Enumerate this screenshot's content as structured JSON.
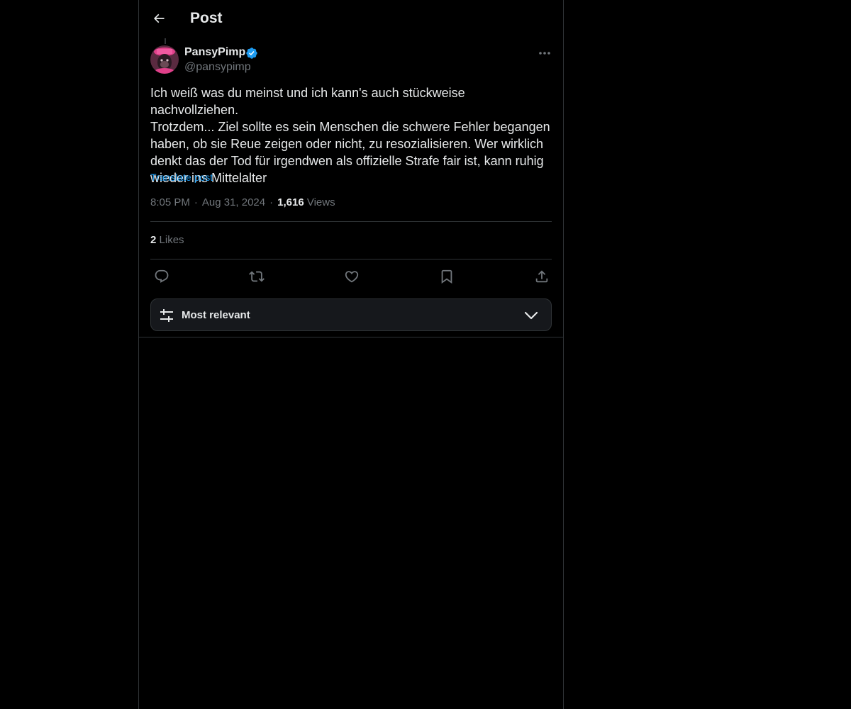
{
  "header": {
    "title": "Post"
  },
  "author": {
    "name": "PansyPimp",
    "handle": "@pansypimp",
    "verified": true
  },
  "post": {
    "text": "Ich weiß was du meinst und ich kann's auch stückweise nachvollziehen.\nTrotzdem... Ziel sollte es sein Menschen die schwere Fehler begangen haben, ob sie Reue zeigen oder nicht, zu resozialisieren. Wer wirklich denkt das der Tod für irgendwen als offizielle Strafe fair ist, kann ruhig wieder ins Mittelalter",
    "translate_label": "Translate post",
    "time": "8:05 PM",
    "separator": "·",
    "date": "Aug 31, 2024",
    "views_count": "1,616",
    "views_label": "Views"
  },
  "engagement": {
    "likes_count": "2",
    "likes_label": "Likes"
  },
  "actions": {
    "icons": [
      "reply-icon",
      "repost-icon",
      "like-icon",
      "bookmark-icon",
      "share-icon"
    ]
  },
  "sort": {
    "label": "Most relevant"
  },
  "colors": {
    "background": "#000000",
    "text": "#e7e9ea",
    "secondary": "#71767b",
    "accent": "#1d9bf0",
    "border": "#2f3336"
  }
}
